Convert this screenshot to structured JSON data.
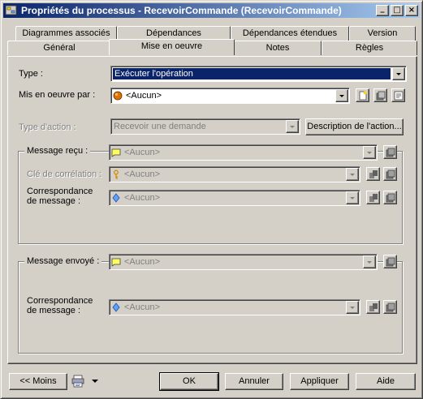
{
  "window": {
    "title": "Propriétés du processus - RecevoirCommande (RecevoirCommande)",
    "minimize_glyph": "_",
    "maximize_glyph": "□",
    "close_glyph": "×"
  },
  "tabs": {
    "row1": [
      "Diagrammes associés",
      "Dépendances",
      "Dépendances étendues",
      "Version"
    ],
    "row2": [
      "Général",
      "Mise en oeuvre",
      "Notes",
      "Règles"
    ],
    "active": "Mise en oeuvre"
  },
  "form": {
    "type_label": "Type :",
    "type_value": "Exécuter l'opération",
    "implemented_by_label": "Mis en oeuvre par :",
    "implemented_by_value": "<Aucun>",
    "action_type_label": "Type d'action :",
    "action_type_value": "Recevoir une demande",
    "action_description_button": "Description de l'action..."
  },
  "received_message": {
    "legend": "Message reçu :",
    "value": "<Aucun>",
    "correlation_key_label": "Clé de corrélation :",
    "correlation_key_value": "<Aucun>",
    "mapping_label_line1": "Correspondance",
    "mapping_label_line2": "de message :",
    "mapping_value": "<Aucun>"
  },
  "sent_message": {
    "legend": "Message envoyé :",
    "value": "<Aucun>",
    "mapping_label_line1": "Correspondance",
    "mapping_label_line2": "de message :",
    "mapping_value": "<Aucun>"
  },
  "footer": {
    "less_button": "<< Moins",
    "ok_button": "OK",
    "cancel_button": "Annuler",
    "apply_button": "Appliquer",
    "help_button": "Aide"
  },
  "icons": {
    "title": "process-icon",
    "implemented_by": "orange-ball-icon",
    "message": "message-envelope-icon",
    "key": "key-icon",
    "mapping": "diamond-icon"
  },
  "colors": {
    "title_bar_start": "#0a246a",
    "title_bar_end": "#a6caf0",
    "selection": "#0a246a",
    "face": "#d4d0c8"
  }
}
